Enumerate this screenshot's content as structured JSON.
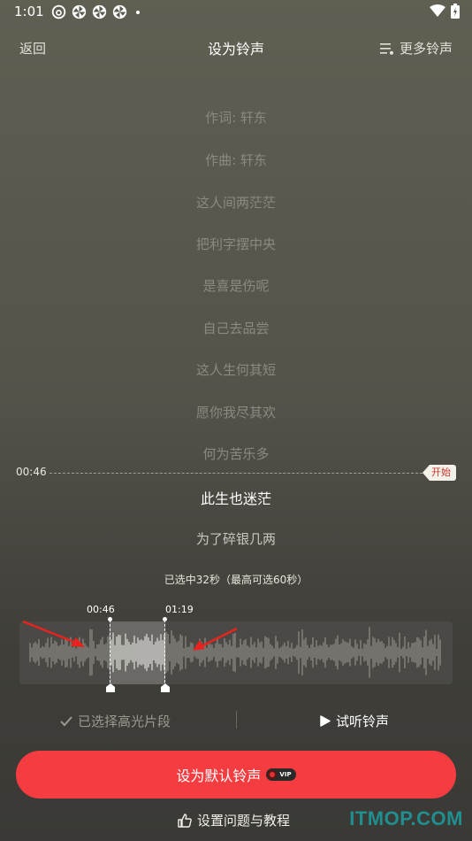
{
  "status_bar": {
    "time": "1:01",
    "icons_left": [
      "netease-icon",
      "pinwheel-icon",
      "pinwheel-icon",
      "pinwheel-icon"
    ],
    "icons_right": [
      "wifi-icon",
      "battery-charging-icon"
    ]
  },
  "header": {
    "back_label": "返回",
    "title": "设为铃声",
    "more_label": "更多铃声"
  },
  "lyrics": [
    "作词: 轩东",
    "作曲: 轩东",
    "这人间两茫茫",
    "把利字摆中央",
    "是喜是伤呢",
    "自己去品尝",
    "这人生何其短",
    "愿你我尽其欢",
    "何为苦乐多",
    "此生也迷茫",
    "为了碎银几两"
  ],
  "active_lyric_index": 9,
  "time_marker": {
    "time": "00:46",
    "start_label": "开始"
  },
  "selection": {
    "info": "已选中32秒（最高可选60秒）",
    "start_time": "00:46",
    "end_time": "01:19"
  },
  "actions": {
    "highlight_label": "已选择高光片段",
    "preview_label": "试听铃声"
  },
  "main_button": {
    "label": "设为默认铃声",
    "vip_label": "VIP"
  },
  "help_label": "设置问题与教程",
  "watermark": "ITMOP.COM",
  "colors": {
    "accent_red": "#f53c40",
    "start_tag_text": "#c8382f",
    "watermark": "#1f8f8f"
  }
}
